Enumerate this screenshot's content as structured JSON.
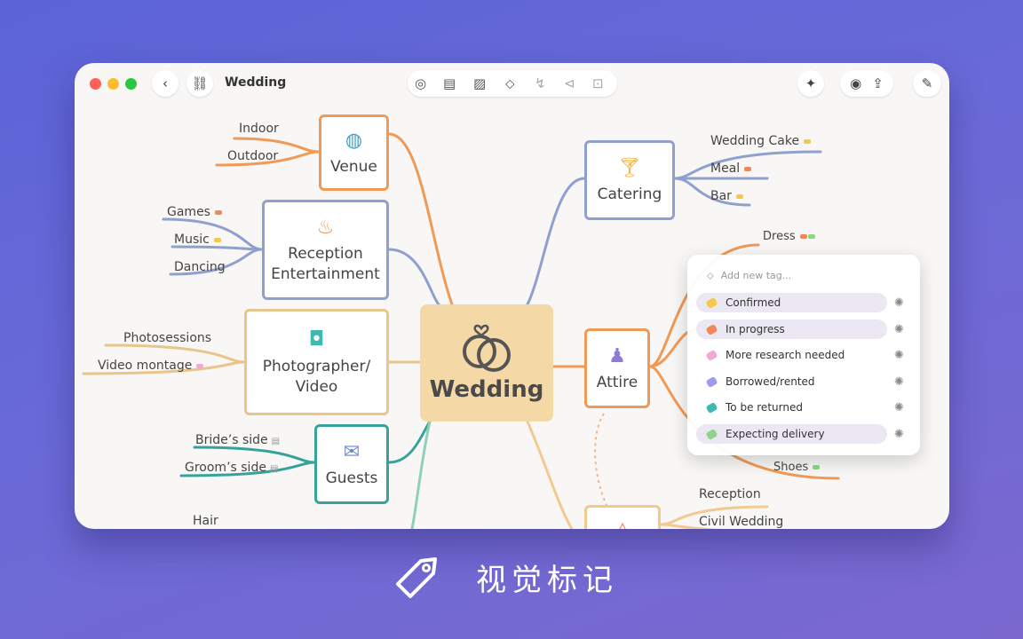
{
  "window": {
    "title": "Wedding",
    "toolbar_icons": [
      "back-chevron-icon",
      "mindmap-icon",
      "task-check-icon",
      "note-icon",
      "image-icon",
      "tag-icon",
      "relation-icon",
      "back-icon",
      "focus-icon",
      "magic-icon",
      "share-collab-icon",
      "export-icon",
      "brush-icon"
    ]
  },
  "center": {
    "label": "Wedding"
  },
  "nodes": {
    "venue": "Venue",
    "reception": "Reception\nEntertainment",
    "photographer": "Photographer/\nVideo",
    "guests": "Guests",
    "catering": "Catering",
    "attire": "Attire"
  },
  "leaves": {
    "indoor": "Indoor",
    "outdoor": "Outdoor",
    "games": "Games",
    "music": "Music",
    "dancing": "Dancing",
    "photosessions": "Photosessions",
    "video_montage": "Video montage",
    "brides_side": "Bride’s side",
    "grooms_side": "Groom’s side",
    "hair": "Hair",
    "wedding_cake": "Wedding Cake",
    "meal": "Meal",
    "bar": "Bar",
    "dress": "Dress",
    "shoes": "Shoes",
    "reception2": "Reception",
    "civil_wedding": "Civil Wedding"
  },
  "tag_popup": {
    "placeholder": "Add new tag...",
    "tags": [
      {
        "label": "Confirmed",
        "color": "#f6c74a",
        "selected": true
      },
      {
        "label": "In progress",
        "color": "#f0875a",
        "selected": true
      },
      {
        "label": "More research needed",
        "color": "#f0a9d0",
        "selected": false
      },
      {
        "label": "Borrowed/rented",
        "color": "#9d9cf0",
        "selected": false
      },
      {
        "label": "To be returned",
        "color": "#3fb8b0",
        "selected": false
      },
      {
        "label": "Expecting delivery",
        "color": "#8fd48a",
        "selected": true
      }
    ]
  },
  "caption": {
    "text": "视觉标记"
  },
  "colors": {
    "orange": "#ef9a56",
    "blue": "#8fa0cf",
    "gold": "#e8c58a",
    "teal": "#36a39a",
    "peach": "#f3c98f"
  }
}
